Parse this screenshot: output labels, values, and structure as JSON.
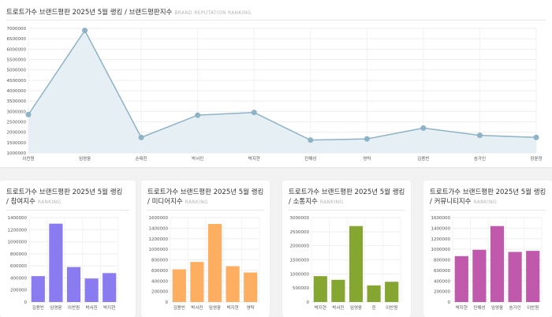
{
  "main": {
    "title": "트로트가수 브랜드평판 2025년 5월 랭킹 / 브랜드평판지수",
    "subtitle": "BRAND REPUTATION RANKING",
    "chart_data": {
      "type": "area",
      "categories": [
        "이찬원",
        "임영웅",
        "손태진",
        "박서진",
        "박지현",
        "진해성",
        "영탁",
        "김용빈",
        "송가인",
        "장윤정"
      ],
      "values": [
        2850000,
        6900000,
        1750000,
        2820000,
        2950000,
        1620000,
        1680000,
        2200000,
        1850000,
        1750000
      ],
      "ylim": [
        1000000,
        7000000
      ],
      "yticks": [
        1000000,
        1500000,
        2000000,
        2500000,
        3000000,
        3500000,
        4000000,
        4500000,
        5000000,
        5500000,
        6000000,
        6500000,
        7000000
      ],
      "color": "#8fb3c6",
      "grid": true
    }
  },
  "cards": [
    {
      "title": "트로트가수 브랜드평판 2025년 5월 랭킹 / 참여지수",
      "subtitle": "RANKING",
      "chart_data": {
        "type": "bar",
        "categories": [
          "김용빈",
          "임영웅",
          "이찬원",
          "박서진",
          "박지현"
        ],
        "values": [
          430000,
          1300000,
          580000,
          390000,
          480000
        ],
        "ylim": [
          0,
          1400000
        ],
        "yticks": [
          0,
          200000,
          400000,
          600000,
          800000,
          1000000,
          1200000,
          1400000
        ],
        "color": "#8a7cf0"
      }
    },
    {
      "title": "트로트가수 브랜드평판 2025년 5월 랭킹 / 미디어지수",
      "subtitle": "RANKING",
      "chart_data": {
        "type": "bar",
        "categories": [
          "김용빈",
          "박서진",
          "임영웅",
          "박지현",
          "영탁"
        ],
        "values": [
          620000,
          760000,
          1480000,
          680000,
          560000
        ],
        "ylim": [
          0,
          1600000
        ],
        "yticks": [
          0,
          200000,
          400000,
          600000,
          800000,
          1000000,
          1200000,
          1400000,
          1600000
        ],
        "color": "#fdae61"
      }
    },
    {
      "title": "트로트가수 브랜드평판 2025년 5월 랭킹 / 소통지수",
      "subtitle": "RANKING",
      "chart_data": {
        "type": "bar",
        "categories": [
          "박지현",
          "박서진",
          "임영웅",
          "린",
          "이찬원"
        ],
        "values": [
          920000,
          790000,
          2700000,
          590000,
          720000
        ],
        "ylim": [
          0,
          3000000
        ],
        "yticks": [
          0,
          500000,
          1000000,
          1500000,
          2000000,
          2500000,
          3000000
        ],
        "color": "#86a632"
      }
    },
    {
      "title": "트로트가수 브랜드평판 2025년 5월 랭킹 / 커뮤니티지수",
      "subtitle": "RANKING",
      "chart_data": {
        "type": "bar",
        "categories": [
          "박지현",
          "진해성",
          "임영웅",
          "송가인",
          "이찬원"
        ],
        "values": [
          870000,
          990000,
          1440000,
          950000,
          970000
        ],
        "ylim": [
          0,
          1600000
        ],
        "yticks": [
          0,
          200000,
          400000,
          600000,
          800000,
          1000000,
          1200000,
          1400000,
          1600000
        ],
        "color": "#c058ac"
      }
    }
  ]
}
